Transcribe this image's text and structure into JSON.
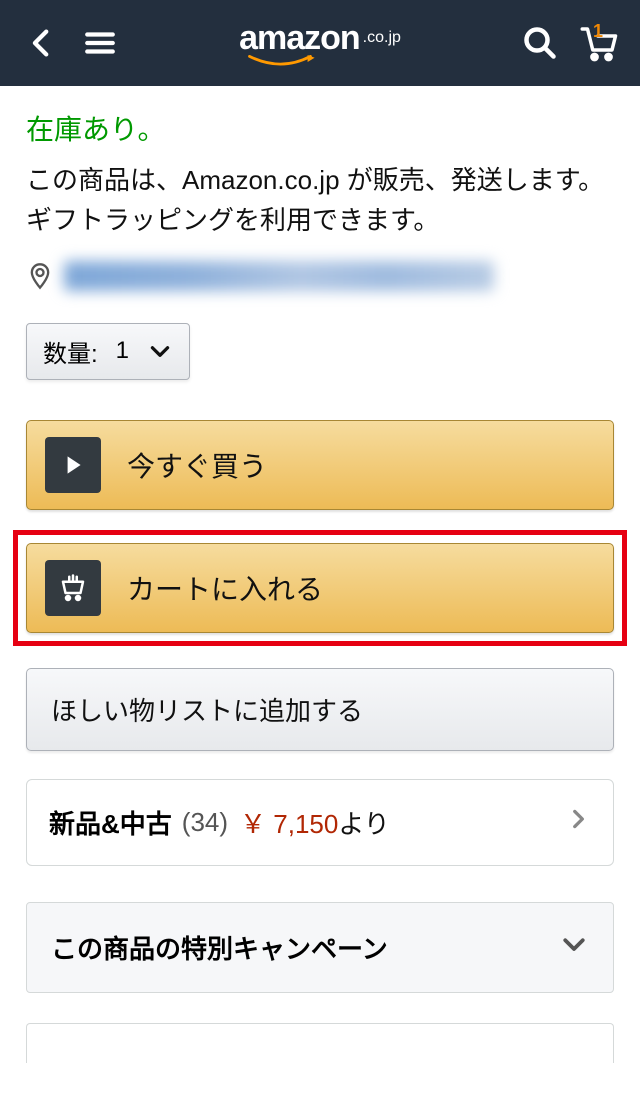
{
  "header": {
    "logo_main": "amazon",
    "logo_suffix": ".co.jp",
    "cart_count": "1"
  },
  "stock_status": "在庫あり。",
  "seller_text": "この商品は、Amazon.co.jp が販売、発送します。 ギフトラッピングを利用できます。",
  "quantity": {
    "label": "数量:",
    "value": "1"
  },
  "buttons": {
    "buy_now": "今すぐ買う",
    "add_to_cart": "カートに入れる",
    "wishlist": "ほしい物リストに追加する"
  },
  "offers": {
    "label": "新品&中古",
    "count": "(34)",
    "price": "￥ 7,150",
    "suffix": "より"
  },
  "campaign": {
    "title": "この商品の特別キャンペーン"
  }
}
